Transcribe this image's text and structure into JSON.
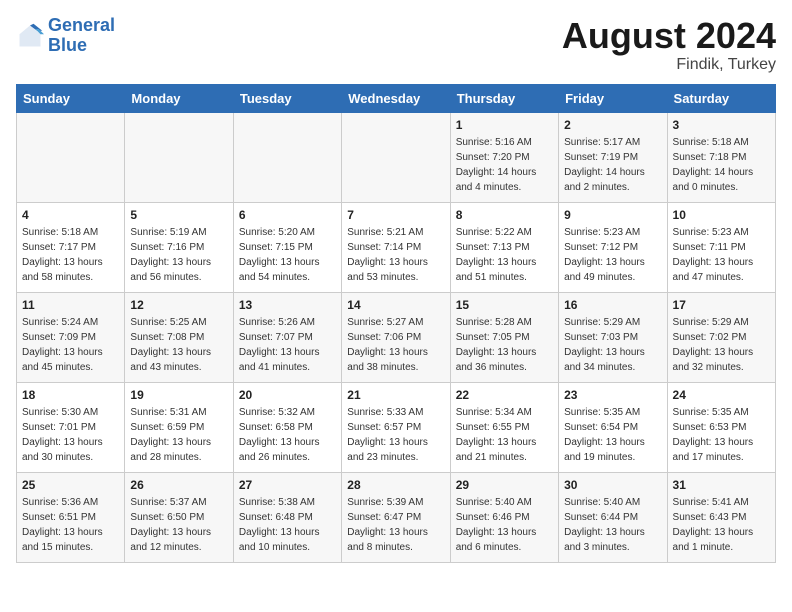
{
  "header": {
    "logo_line1": "General",
    "logo_line2": "Blue",
    "month": "August 2024",
    "location": "Findik, Turkey"
  },
  "days_of_week": [
    "Sunday",
    "Monday",
    "Tuesday",
    "Wednesday",
    "Thursday",
    "Friday",
    "Saturday"
  ],
  "weeks": [
    [
      {
        "day": "",
        "info": ""
      },
      {
        "day": "",
        "info": ""
      },
      {
        "day": "",
        "info": ""
      },
      {
        "day": "",
        "info": ""
      },
      {
        "day": "1",
        "info": "Sunrise: 5:16 AM\nSunset: 7:20 PM\nDaylight: 14 hours\nand 4 minutes."
      },
      {
        "day": "2",
        "info": "Sunrise: 5:17 AM\nSunset: 7:19 PM\nDaylight: 14 hours\nand 2 minutes."
      },
      {
        "day": "3",
        "info": "Sunrise: 5:18 AM\nSunset: 7:18 PM\nDaylight: 14 hours\nand 0 minutes."
      }
    ],
    [
      {
        "day": "4",
        "info": "Sunrise: 5:18 AM\nSunset: 7:17 PM\nDaylight: 13 hours\nand 58 minutes."
      },
      {
        "day": "5",
        "info": "Sunrise: 5:19 AM\nSunset: 7:16 PM\nDaylight: 13 hours\nand 56 minutes."
      },
      {
        "day": "6",
        "info": "Sunrise: 5:20 AM\nSunset: 7:15 PM\nDaylight: 13 hours\nand 54 minutes."
      },
      {
        "day": "7",
        "info": "Sunrise: 5:21 AM\nSunset: 7:14 PM\nDaylight: 13 hours\nand 53 minutes."
      },
      {
        "day": "8",
        "info": "Sunrise: 5:22 AM\nSunset: 7:13 PM\nDaylight: 13 hours\nand 51 minutes."
      },
      {
        "day": "9",
        "info": "Sunrise: 5:23 AM\nSunset: 7:12 PM\nDaylight: 13 hours\nand 49 minutes."
      },
      {
        "day": "10",
        "info": "Sunrise: 5:23 AM\nSunset: 7:11 PM\nDaylight: 13 hours\nand 47 minutes."
      }
    ],
    [
      {
        "day": "11",
        "info": "Sunrise: 5:24 AM\nSunset: 7:09 PM\nDaylight: 13 hours\nand 45 minutes."
      },
      {
        "day": "12",
        "info": "Sunrise: 5:25 AM\nSunset: 7:08 PM\nDaylight: 13 hours\nand 43 minutes."
      },
      {
        "day": "13",
        "info": "Sunrise: 5:26 AM\nSunset: 7:07 PM\nDaylight: 13 hours\nand 41 minutes."
      },
      {
        "day": "14",
        "info": "Sunrise: 5:27 AM\nSunset: 7:06 PM\nDaylight: 13 hours\nand 38 minutes."
      },
      {
        "day": "15",
        "info": "Sunrise: 5:28 AM\nSunset: 7:05 PM\nDaylight: 13 hours\nand 36 minutes."
      },
      {
        "day": "16",
        "info": "Sunrise: 5:29 AM\nSunset: 7:03 PM\nDaylight: 13 hours\nand 34 minutes."
      },
      {
        "day": "17",
        "info": "Sunrise: 5:29 AM\nSunset: 7:02 PM\nDaylight: 13 hours\nand 32 minutes."
      }
    ],
    [
      {
        "day": "18",
        "info": "Sunrise: 5:30 AM\nSunset: 7:01 PM\nDaylight: 13 hours\nand 30 minutes."
      },
      {
        "day": "19",
        "info": "Sunrise: 5:31 AM\nSunset: 6:59 PM\nDaylight: 13 hours\nand 28 minutes."
      },
      {
        "day": "20",
        "info": "Sunrise: 5:32 AM\nSunset: 6:58 PM\nDaylight: 13 hours\nand 26 minutes."
      },
      {
        "day": "21",
        "info": "Sunrise: 5:33 AM\nSunset: 6:57 PM\nDaylight: 13 hours\nand 23 minutes."
      },
      {
        "day": "22",
        "info": "Sunrise: 5:34 AM\nSunset: 6:55 PM\nDaylight: 13 hours\nand 21 minutes."
      },
      {
        "day": "23",
        "info": "Sunrise: 5:35 AM\nSunset: 6:54 PM\nDaylight: 13 hours\nand 19 minutes."
      },
      {
        "day": "24",
        "info": "Sunrise: 5:35 AM\nSunset: 6:53 PM\nDaylight: 13 hours\nand 17 minutes."
      }
    ],
    [
      {
        "day": "25",
        "info": "Sunrise: 5:36 AM\nSunset: 6:51 PM\nDaylight: 13 hours\nand 15 minutes."
      },
      {
        "day": "26",
        "info": "Sunrise: 5:37 AM\nSunset: 6:50 PM\nDaylight: 13 hours\nand 12 minutes."
      },
      {
        "day": "27",
        "info": "Sunrise: 5:38 AM\nSunset: 6:48 PM\nDaylight: 13 hours\nand 10 minutes."
      },
      {
        "day": "28",
        "info": "Sunrise: 5:39 AM\nSunset: 6:47 PM\nDaylight: 13 hours\nand 8 minutes."
      },
      {
        "day": "29",
        "info": "Sunrise: 5:40 AM\nSunset: 6:46 PM\nDaylight: 13 hours\nand 6 minutes."
      },
      {
        "day": "30",
        "info": "Sunrise: 5:40 AM\nSunset: 6:44 PM\nDaylight: 13 hours\nand 3 minutes."
      },
      {
        "day": "31",
        "info": "Sunrise: 5:41 AM\nSunset: 6:43 PM\nDaylight: 13 hours\nand 1 minute."
      }
    ]
  ]
}
